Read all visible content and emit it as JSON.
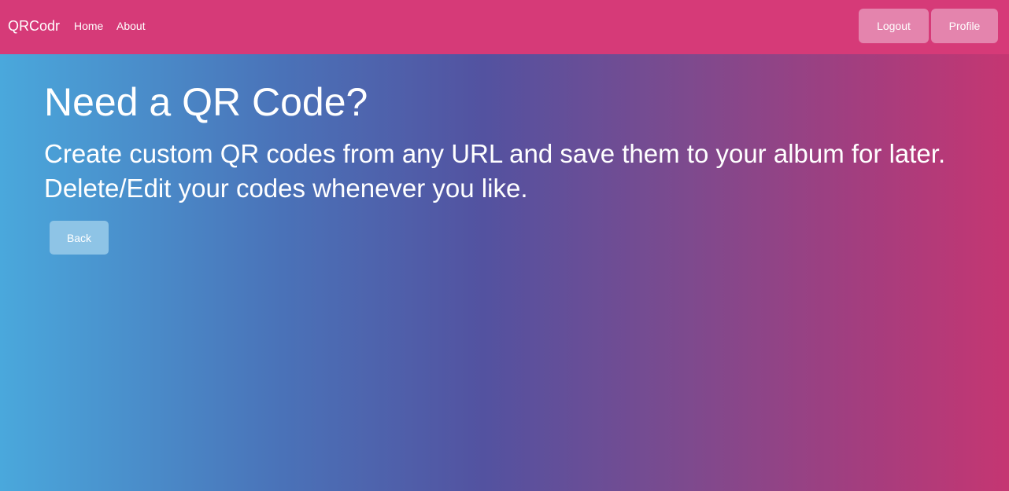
{
  "navbar": {
    "brand": "QRCodr",
    "links": [
      {
        "label": "Home"
      },
      {
        "label": "About"
      }
    ],
    "buttons": {
      "logout": "Logout",
      "profile": "Profile"
    },
    "background_color": "#d63a78",
    "button_color": "#e484ad"
  },
  "hero": {
    "title": "Need a QR Code?",
    "description": "Create custom QR codes from any URL and save them to your album for later. Delete/Edit your codes whenever you like.",
    "back_label": "Back",
    "back_button_color": "#8ec4e6"
  },
  "theme": {
    "gradient": [
      "#4aa8dc",
      "#5352a0",
      "#c53672"
    ]
  }
}
